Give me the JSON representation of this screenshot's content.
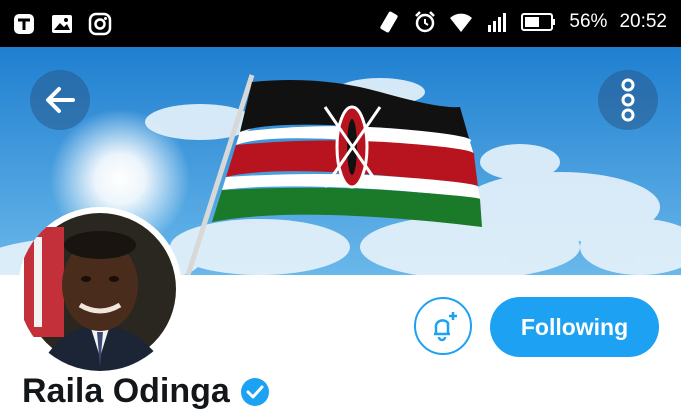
{
  "status_bar": {
    "battery_percent": "56%",
    "time": "20:52",
    "left_icons": [
      "app-icon",
      "gallery-icon",
      "instagram-icon"
    ],
    "right_icons": [
      "vibrate-icon",
      "alarm-icon",
      "wifi-icon",
      "signal-icon",
      "battery-icon"
    ]
  },
  "header": {
    "back_icon": "arrow-left-icon",
    "more_icon": "more-vertical-icon"
  },
  "profile": {
    "name": "Raila Odinga",
    "verified": true,
    "follow_label": "Following",
    "notify_icon": "bell-plus-icon"
  },
  "colors": {
    "accent": "#1da1f2",
    "flag_black": "#111111",
    "flag_red": "#b8141f",
    "flag_green": "#1a7a2a"
  }
}
